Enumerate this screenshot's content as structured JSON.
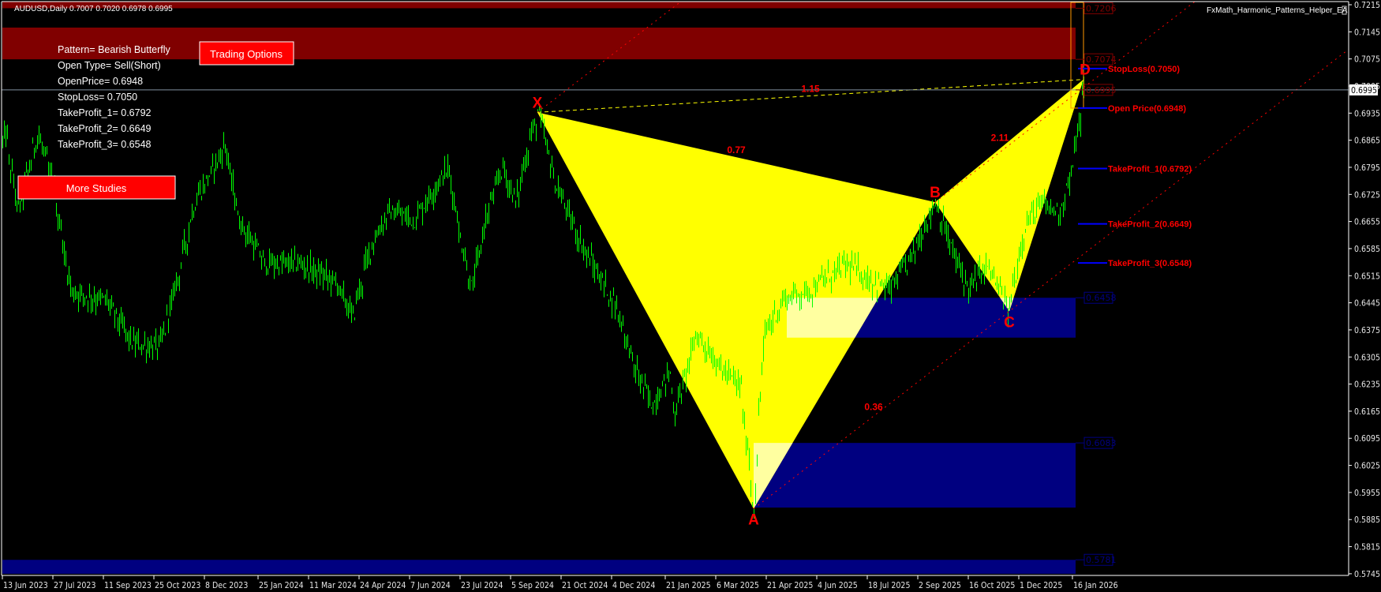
{
  "header": {
    "symbol_info": "AUDUSD,Daily  0.7007 0.7020 0.6978 0.6995",
    "ea_name": "FxMath_Harmonic_Patterns_Helper_EA"
  },
  "panel": {
    "lines": [
      "Pattern= Bearish Butterfly",
      "Open Type= Sell(Short)",
      "OpenPrice= 0.6948",
      "StopLoss= 0.7050",
      "TakeProfit_1= 0.6792",
      "TakeProfit_2= 0.6649",
      "TakeProfit_3= 0.6548"
    ],
    "trading_options_label": "Trading Options",
    "more_studies_label": "More Studies"
  },
  "chart_data": {
    "type": "ohlc",
    "symbol": "AUDUSD",
    "timeframe": "Daily",
    "ylim": [
      0.5745,
      0.7215
    ],
    "y_ticks": [
      "0.7215",
      "0.7145",
      "0.7075",
      "0.7005",
      "0.6935",
      "0.6865",
      "0.6795",
      "0.6725",
      "0.6655",
      "0.6585",
      "0.6515",
      "0.6445",
      "0.6375",
      "0.6305",
      "0.6235",
      "0.6165",
      "0.6095",
      "0.6025",
      "0.5955",
      "0.5885",
      "0.5815",
      "0.5745"
    ],
    "x_ticks": [
      "13 Jun 2023",
      "27 Jul 2023",
      "11 Sep 2023",
      "25 Oct 2023",
      "8 Dec 2023",
      "25 Jan 2024",
      "11 Mar 2024",
      "24 Apr 2024",
      "7 Jun 2024",
      "23 Jul 2024",
      "5 Sep 2024",
      "21 Oct 2024",
      "4 Dec 2024",
      "21 Jan 2025",
      "6 Mar 2025",
      "21 Apr 2025",
      "4 Jun 2025",
      "18 Jul 2025",
      "2 Sep 2025",
      "16 Oct 2025",
      "1 Dec 2025",
      "16 Jan 2026"
    ],
    "current_price": "0.6995",
    "price_path": [
      [
        "2023-06-13",
        0.686
      ],
      [
        "2023-06-15",
        0.6885
      ],
      [
        "2023-06-26",
        0.668
      ],
      [
        "2023-07-14",
        0.6885
      ],
      [
        "2023-07-28",
        0.674
      ],
      [
        "2023-08-12",
        0.6475
      ],
      [
        "2023-09-13",
        0.645
      ],
      [
        "2023-10-06",
        0.6339
      ],
      [
        "2023-10-30",
        0.633
      ],
      [
        "2023-11-14",
        0.65
      ],
      [
        "2023-11-30",
        0.6703
      ],
      [
        "2023-12-27",
        0.6851
      ],
      [
        "2024-01-08",
        0.666
      ],
      [
        "2024-01-31",
        0.6546
      ],
      [
        "2024-03-02",
        0.6546
      ],
      [
        "2024-04-03",
        0.65
      ],
      [
        "2024-04-18",
        0.641
      ],
      [
        "2024-05-04",
        0.659
      ],
      [
        "2024-05-20",
        0.668
      ],
      [
        "2024-06-12",
        0.666
      ],
      [
        "2024-07-06",
        0.6771
      ],
      [
        "2024-07-13",
        0.679
      ],
      [
        "2024-07-21",
        0.6635
      ],
      [
        "2024-08-02",
        0.6475
      ],
      [
        "2024-08-14",
        0.666
      ],
      [
        "2024-08-29",
        0.6795
      ],
      [
        "2024-09-10",
        0.6705
      ],
      [
        "2024-09-22",
        0.6865
      ],
      [
        "2024-09-30",
        0.6937
      ],
      [
        "2024-10-15",
        0.675
      ],
      [
        "2024-11-08",
        0.659
      ],
      [
        "2024-12-09",
        0.643
      ],
      [
        "2024-12-25",
        0.627
      ],
      [
        "2025-01-09",
        0.618
      ],
      [
        "2025-01-25",
        0.627
      ],
      [
        "2025-01-29",
        0.616
      ],
      [
        "2025-02-17",
        0.6365
      ],
      [
        "2025-03-12",
        0.627
      ],
      [
        "2025-03-28",
        0.623
      ],
      [
        "2025-04-09",
        0.5913
      ],
      [
        "2025-04-18",
        0.6365
      ],
      [
        "2025-05-06",
        0.6455
      ],
      [
        "2025-05-30",
        0.648
      ],
      [
        "2025-06-30",
        0.6545
      ],
      [
        "2025-07-23",
        0.65
      ],
      [
        "2025-08-08",
        0.648
      ],
      [
        "2025-08-23",
        0.6545
      ],
      [
        "2025-09-17",
        0.6705
      ],
      [
        "2025-10-03",
        0.657
      ],
      [
        "2025-10-17",
        0.648
      ],
      [
        "2025-11-02",
        0.6545
      ],
      [
        "2025-11-21",
        0.6423
      ],
      [
        "2025-12-05",
        0.664
      ],
      [
        "2025-12-19",
        0.67
      ],
      [
        "2026-01-05",
        0.668
      ],
      [
        "2026-01-15",
        0.677
      ],
      [
        "2026-01-27",
        0.6995
      ]
    ],
    "pattern": {
      "name": "Bearish Butterfly",
      "points": [
        {
          "label": "X",
          "date": "2024-09-30",
          "price": 0.6937
        },
        {
          "label": "A",
          "date": "2025-04-09",
          "price": 0.5913
        },
        {
          "label": "B",
          "date": "2025-09-17",
          "price": 0.6705
        },
        {
          "label": "C",
          "date": "2025-11-21",
          "price": 0.6423
        },
        {
          "label": "D",
          "date": "2026-01-27",
          "price": 0.7022
        }
      ],
      "ratios": {
        "XB": "0.77",
        "XD": "1.15",
        "BD": "2.11",
        "AC": "0.36"
      },
      "fill_color": "#ffff00"
    },
    "levels": [
      {
        "label": "StopLoss(0.7050)",
        "price": 0.705
      },
      {
        "label": "Open Price(0.6948)",
        "price": 0.6948
      },
      {
        "label": "TakeProfit_1(0.6792)",
        "price": 0.6792
      },
      {
        "label": "TakeProfit_2(0.6649)",
        "price": 0.6649
      },
      {
        "label": "TakeProfit_3(0.6548)",
        "price": 0.6548
      }
    ],
    "zones": {
      "supply": [
        {
          "label": "0.7206",
          "low": 0.7206,
          "high": 0.724,
          "start": "2023-06-13"
        },
        {
          "label": "0.7074",
          "low": 0.7074,
          "high": 0.7156,
          "start": "2023-06-13"
        }
      ],
      "demand": [
        {
          "label": "0.6458",
          "high": 0.6458,
          "low": 0.6355,
          "start": "2025-05-08"
        },
        {
          "label": "0.6083",
          "high": 0.6083,
          "low": 0.5916,
          "start": "2025-04-09"
        },
        {
          "label": "0.5781",
          "high": 0.5781,
          "low": 0.5745,
          "start": "2023-06-13"
        }
      ],
      "current_box_label": "0.6995",
      "supply_color": "#800000",
      "demand_color": "#000080"
    },
    "colors": {
      "bars": "#00ff00",
      "background": "#000000",
      "levels_line": "#0000ff",
      "labels": "#ff0000",
      "d_box": "#ff9900"
    }
  }
}
